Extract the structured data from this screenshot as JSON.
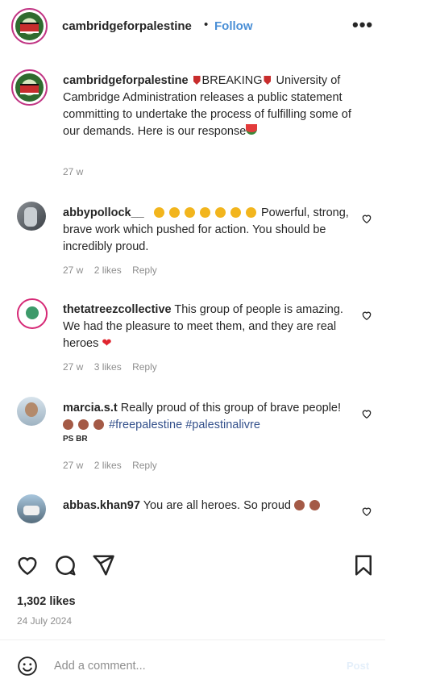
{
  "header": {
    "username": "cambridgeforpalestine",
    "separator": "•",
    "follow_label": "Follow",
    "more_label": "•••"
  },
  "caption": {
    "username": "cambridgeforpalestine",
    "breaking": "BREAKING",
    "text": "University of Cambridge Administration releases a public statement committing to undertake the process of fulfilling some of our demands. Here is our response",
    "time": "27 w"
  },
  "comments": [
    {
      "username": "abbypollock__",
      "text": "Powerful, strong, brave work which pushed for action. You should be incredibly proud.",
      "time": "27 w",
      "likes": "2 likes",
      "reply": "Reply"
    },
    {
      "username": "thetatreezcollective",
      "text": "This group of people is amazing. We had the pleasure to meet them, and they are real heroes",
      "time": "27 w",
      "likes": "3 likes",
      "reply": "Reply"
    },
    {
      "username": "marcia.s.t",
      "text": "Really proud of this group of brave people!",
      "tags": "#freepalestine #palestinalivre",
      "small_tag": "PS BR",
      "time": "27 w",
      "likes": "2 likes",
      "reply": "Reply"
    },
    {
      "username": "abbas.khan97",
      "text": "You are all heroes. So proud"
    }
  ],
  "post": {
    "likes": "1,302 likes",
    "date": "24 July 2024"
  },
  "comment_box": {
    "placeholder": "Add a comment...",
    "post_label": "Post"
  },
  "colors": {
    "accent": "#4a8fd6",
    "muted": "#8e8e8e",
    "text": "#262626"
  }
}
